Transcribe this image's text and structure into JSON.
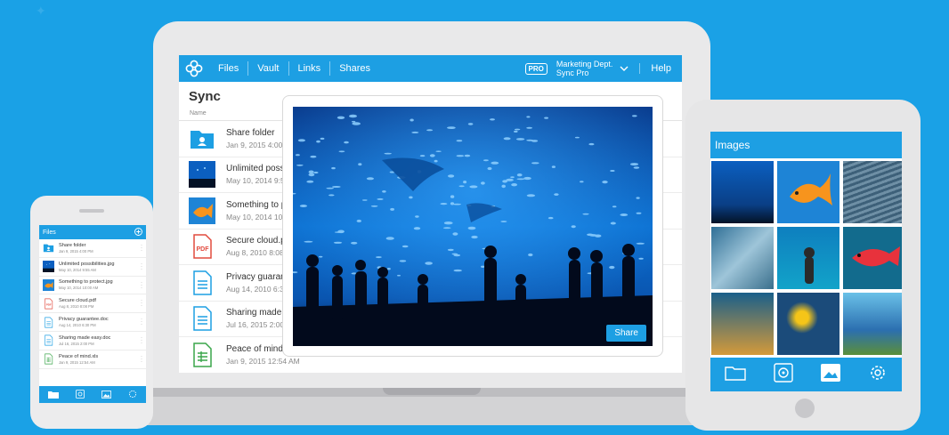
{
  "laptop": {
    "nav": {
      "items": [
        "Files",
        "Vault",
        "Links",
        "Shares"
      ],
      "pro_badge": "PRO",
      "account_line1": "Marketing Dept.",
      "account_line2": "Sync Pro",
      "help": "Help"
    },
    "title": "Sync",
    "column_header": "Name",
    "files": [
      {
        "name": "Share folder",
        "date": "Jan 9, 2015  4:00",
        "icon": "folder-icon"
      },
      {
        "name": "Unlimited possil",
        "date": "May 10, 2014  9:5",
        "icon": "aquarium-thumbnail"
      },
      {
        "name": "Something to pr",
        "date": "May 10, 2014  10",
        "icon": "goldfish-thumbnail"
      },
      {
        "name": "Secure cloud.pd",
        "date": "Aug 8, 2010  8:08",
        "icon": "pdf-icon"
      },
      {
        "name": "Privacy guarante",
        "date": "Aug 14, 2010  6:3",
        "icon": "doc-icon"
      },
      {
        "name": "Sharing made e",
        "date": "Jul 16, 2015  2:00",
        "icon": "doc-icon"
      },
      {
        "name": "Peace of mind.x",
        "date": "Jan 9, 2015  12:54 AM",
        "icon": "spreadsheet-icon"
      }
    ],
    "share_button": "Share"
  },
  "tablet": {
    "title": "Images",
    "footer_icons": [
      "folder-icon",
      "vault-icon",
      "image-icon",
      "gear-icon"
    ]
  },
  "phone": {
    "title": "Files",
    "files": [
      {
        "name": "Share folder",
        "date": "Jan 9, 2015  4:00 PM",
        "icon": "folder-icon"
      },
      {
        "name": "Unlimited possibilities.jpg",
        "date": "May 10, 2014  9:55 AM",
        "icon": "aquarium-thumbnail"
      },
      {
        "name": "Something to protect.jpg",
        "date": "May 10, 2014  10:00 AM",
        "icon": "goldfish-thumbnail"
      },
      {
        "name": "Secure cloud.pdf",
        "date": "Aug 8, 2010  8:08 PM",
        "icon": "pdf-icon"
      },
      {
        "name": "Privacy guarantee.doc",
        "date": "Aug 14, 2010  6:30 PM",
        "icon": "doc-icon"
      },
      {
        "name": "Sharing made easy.doc",
        "date": "Jul 16, 2015  2:00 PM",
        "icon": "doc-icon"
      },
      {
        "name": "Peace of mind.xls",
        "date": "Jan 9, 2015  12:54 AM",
        "icon": "spreadsheet-icon"
      }
    ]
  },
  "colors": {
    "brand_blue": "#1d9fe3",
    "background": "#1aa1e6",
    "pdf_red": "#e24b3f",
    "sheet_green": "#3aa64a"
  }
}
